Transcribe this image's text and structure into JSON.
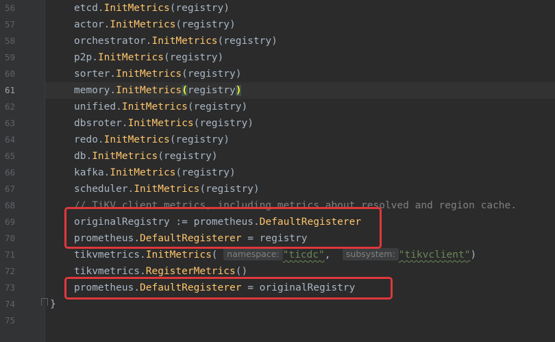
{
  "gutter": {
    "line_numbers": [
      "56",
      "57",
      "58",
      "59",
      "60",
      "61",
      "62",
      "63",
      "64",
      "65",
      "66",
      "67",
      "68",
      "69",
      "70",
      "71",
      "72",
      "73",
      "74",
      "75"
    ],
    "current_line": "61"
  },
  "code": {
    "l56": {
      "pkg": "etcd",
      "fn": "InitMetrics",
      "arg": "registry"
    },
    "l57": {
      "pkg": "actor",
      "fn": "InitMetrics",
      "arg": "registry"
    },
    "l58": {
      "pkg": "orchestrator",
      "fn": "InitMetrics",
      "arg": "registry"
    },
    "l59": {
      "pkg": "p2p",
      "fn": "InitMetrics",
      "arg": "registry"
    },
    "l60": {
      "pkg": "sorter",
      "fn": "InitMetrics",
      "arg": "registry"
    },
    "l61": {
      "pkg": "memory",
      "fn": "InitMetrics",
      "arg": "registry"
    },
    "l62": {
      "pkg": "unified",
      "fn": "InitMetrics",
      "arg": "registry"
    },
    "l63": {
      "pkg": "dbsroter",
      "fn": "InitMetrics",
      "arg": "registry"
    },
    "l64": {
      "pkg": "redo",
      "fn": "InitMetrics",
      "arg": "registry"
    },
    "l65": {
      "pkg": "db",
      "fn": "InitMetrics",
      "arg": "registry"
    },
    "l66": {
      "pkg": "kafka",
      "fn": "InitMetrics",
      "arg": "registry"
    },
    "l67": {
      "pkg": "scheduler",
      "fn": "InitMetrics",
      "arg": "registry"
    },
    "l68": {
      "comment": "// TiKV client metrics, including metrics about resolved and region cache."
    },
    "l69": {
      "var": "originalRegistry",
      "op": ":=",
      "pkg": "prometheus",
      "field": "DefaultRegisterer"
    },
    "l70": {
      "pkg": "prometheus",
      "field": "DefaultRegisterer",
      "op": "=",
      "rhs": "registry"
    },
    "l71": {
      "pkg": "tikvmetrics",
      "fn": "InitMetrics",
      "hint1": "namespace:",
      "str1": "\"ticdc\"",
      "hint2": "subsystem:",
      "str2": "\"tikvclient\""
    },
    "l72": {
      "pkg": "tikvmetrics",
      "fn": "RegisterMetrics"
    },
    "l73": {
      "pkg": "prometheus",
      "field": "DefaultRegisterer",
      "op": "=",
      "rhs": "originalRegistry"
    },
    "l74": {
      "brace": "}"
    }
  },
  "colors": {
    "background": "#2b2b2b",
    "gutter": "#313335",
    "highlight_box": "#e0383c",
    "function": "#ffc66d",
    "string": "#6a8759",
    "comment": "#808080"
  }
}
